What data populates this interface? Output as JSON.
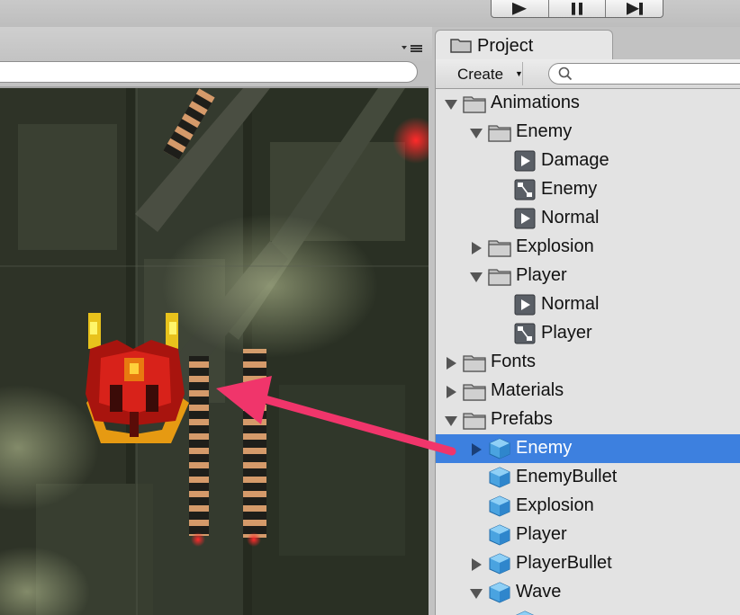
{
  "project_tab": {
    "label": "Project",
    "icon": "folder-icon"
  },
  "toolbar": {
    "create_label": "Create",
    "create_arrow": "▼"
  },
  "tree": [
    {
      "label": "Animations",
      "icon": "folder",
      "depth": 0,
      "expander": "expanded"
    },
    {
      "label": "Enemy",
      "icon": "folder",
      "depth": 1,
      "expander": "expanded"
    },
    {
      "label": "Damage",
      "icon": "animation-clip",
      "depth": 2,
      "expander": "none"
    },
    {
      "label": "Enemy",
      "icon": "animator-controller",
      "depth": 2,
      "expander": "none"
    },
    {
      "label": "Normal",
      "icon": "animation-clip",
      "depth": 2,
      "expander": "none"
    },
    {
      "label": "Explosion",
      "icon": "folder",
      "depth": 1,
      "expander": "collapsed"
    },
    {
      "label": "Player",
      "icon": "folder",
      "depth": 1,
      "expander": "expanded"
    },
    {
      "label": "Normal",
      "icon": "animation-clip",
      "depth": 2,
      "expander": "none"
    },
    {
      "label": "Player",
      "icon": "animator-controller",
      "depth": 2,
      "expander": "none"
    },
    {
      "label": "Fonts",
      "icon": "folder",
      "depth": 0,
      "expander": "collapsed"
    },
    {
      "label": "Materials",
      "icon": "folder",
      "depth": 0,
      "expander": "collapsed"
    },
    {
      "label": "Prefabs",
      "icon": "folder",
      "depth": 0,
      "expander": "expanded"
    },
    {
      "label": "Enemy",
      "icon": "prefab",
      "depth": 1,
      "expander": "collapsed",
      "selected": true
    },
    {
      "label": "EnemyBullet",
      "icon": "prefab",
      "depth": 1,
      "expander": "none"
    },
    {
      "label": "Explosion",
      "icon": "prefab",
      "depth": 1,
      "expander": "none"
    },
    {
      "label": "Player",
      "icon": "prefab",
      "depth": 1,
      "expander": "none"
    },
    {
      "label": "PlayerBullet",
      "icon": "prefab",
      "depth": 1,
      "expander": "collapsed"
    },
    {
      "label": "Wave",
      "icon": "prefab",
      "depth": 1,
      "expander": "expanded"
    },
    {
      "label": "",
      "icon": "prefab",
      "depth": 2,
      "expander": "none"
    }
  ],
  "colors": {
    "selection": "#3d80df",
    "annotation_arrow": "#f0356b",
    "prefab_blue": "#4aa3e0",
    "panel_bg": "#e3e3e3"
  }
}
